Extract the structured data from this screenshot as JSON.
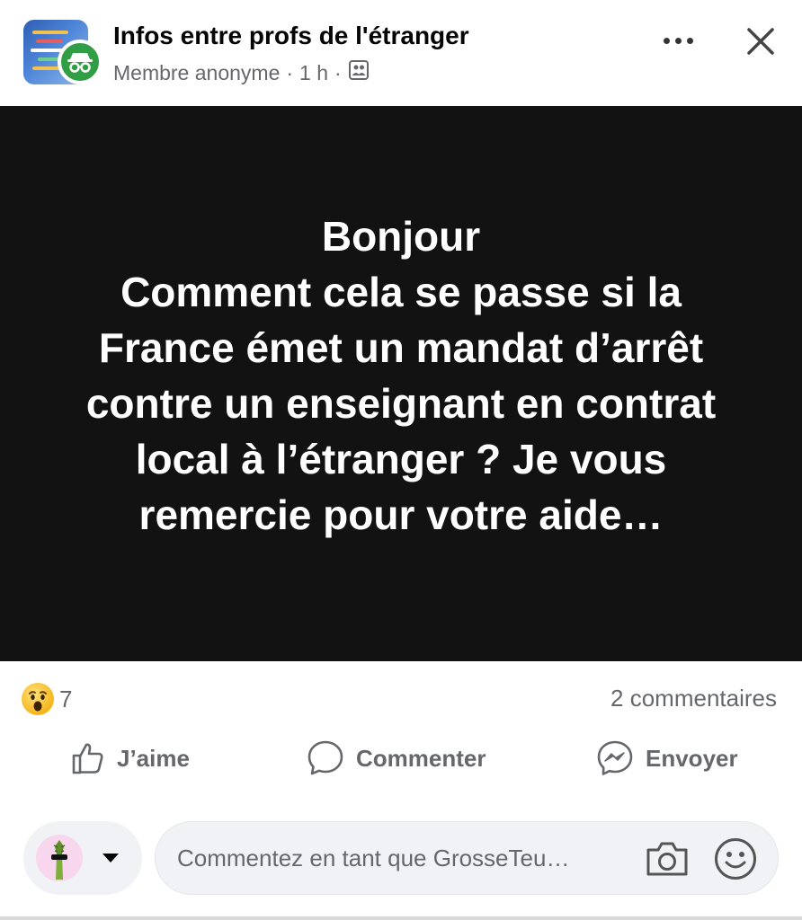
{
  "post": {
    "group_name": "Infos entre profs de l'étranger",
    "author": "Membre anonyme",
    "separator": "·",
    "time": "1 h",
    "audience_icon": "group-audience-icon",
    "image_text_lines": [
      "Bonjour",
      "Comment cela se passe si la France émet un mandat d’arrêt contre un enseignant en contrat local à l’étranger ? Je vous remercie pour votre aide…"
    ],
    "reaction_icon": "wow-emoji",
    "reaction_count": "7",
    "comments_label": "2 commentaires"
  },
  "actions": {
    "like": "J’aime",
    "comment": "Commenter",
    "send": "Envoyer"
  },
  "composer": {
    "placeholder": "Commentez en tant que GrosseTeu…",
    "camera_icon": "camera-icon",
    "emoji_icon": "smiley-icon"
  },
  "colors": {
    "image_background": "#121212",
    "secondary_text": "#65676b",
    "anon_badge": "#2f9e44"
  }
}
